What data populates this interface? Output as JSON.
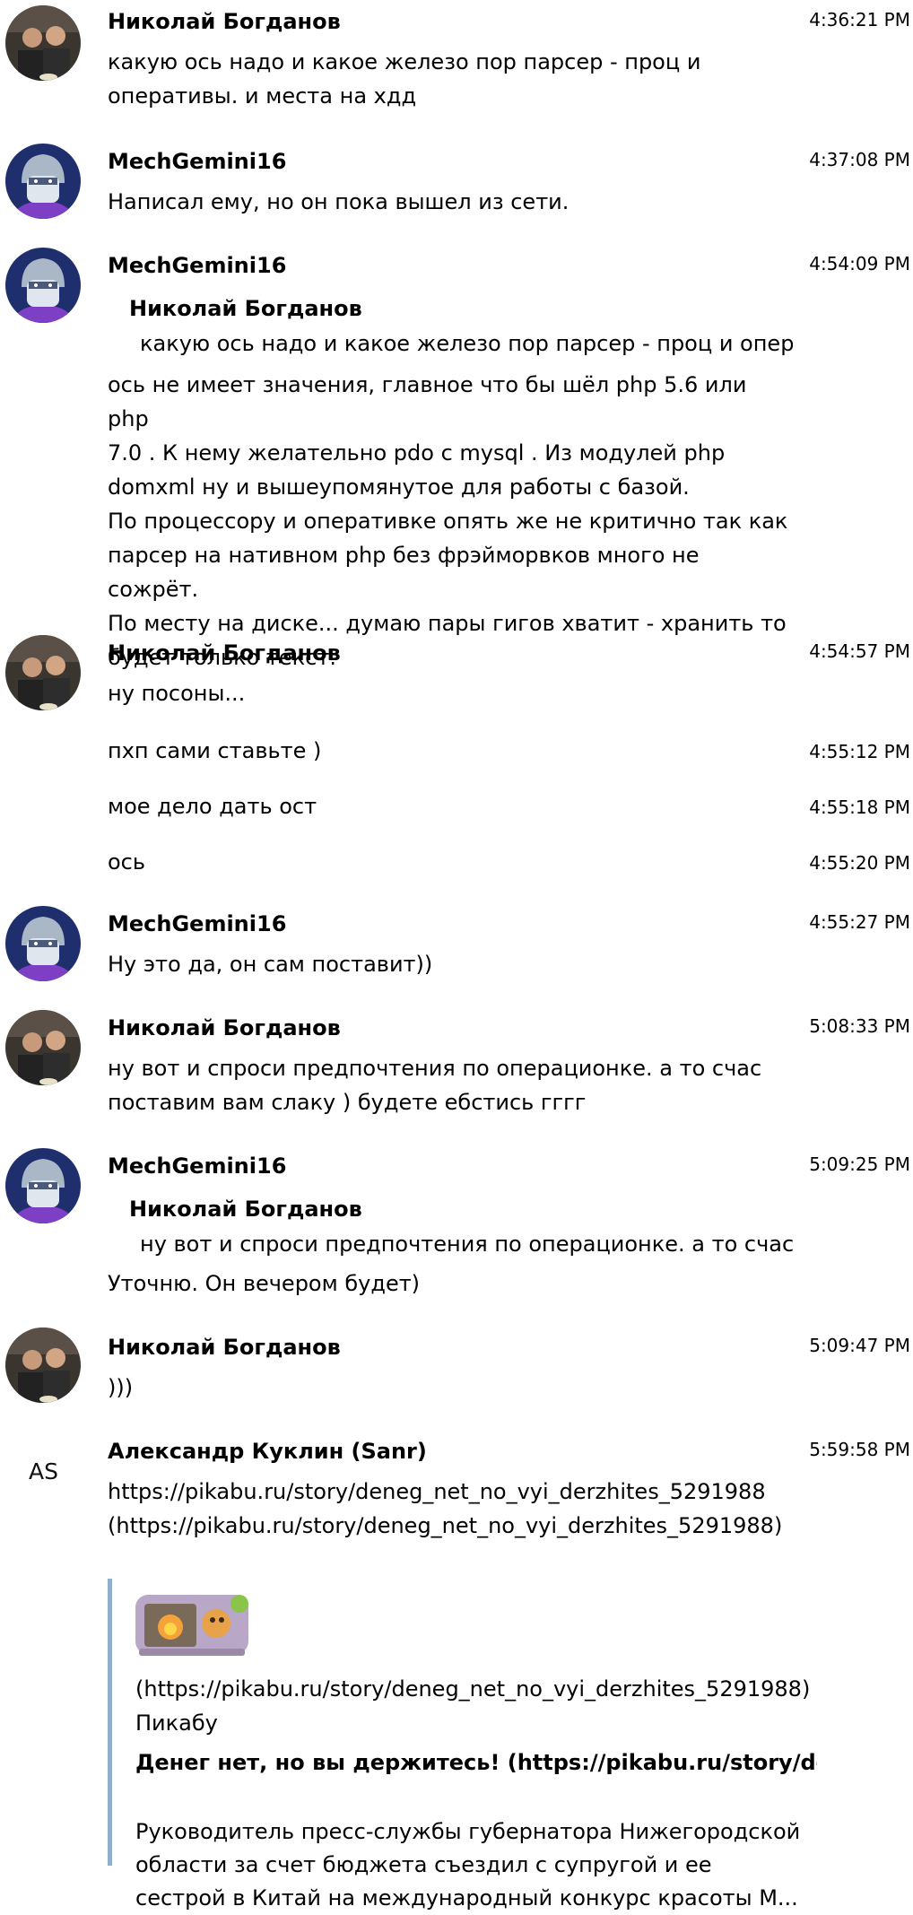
{
  "messages": [
    {
      "author": "Николай Богданов",
      "time": "4:36:21 PM",
      "text": "какую ось надо и какое железо пор парсер - проц и оперативы. и места на хдд"
    },
    {
      "author": "MechGemini16",
      "time": "4:37:08 PM",
      "text": "Написал ему, но он пока вышел из сети."
    },
    {
      "author": "MechGemini16",
      "time": "4:54:09 PM",
      "quote_author": "Николай Богданов",
      "quote_text": "какую ось надо и какое железо пор парсер - проц и опера…",
      "text_lines": [
        "ось не имеет значения, главное что бы шёл php 5.6 или php",
        "7.0  . К нему желательно pdo с mysql .  Из модулей php",
        "domxml ну и вышеупомянутое для работы с базой.",
        "По процессору и оперативке опять же не критично так как",
        "парсер на нативном php без фрэйморвков много не сожрёт.",
        "По месту на диске... думаю пары гигов хватит - хранить то",
        "будет только текст."
      ]
    },
    {
      "author": "Николай Богданов",
      "time": "4:54:57 PM",
      "text": "ну посоны..."
    },
    {
      "time": "4:55:12 PM",
      "text": "пхп сами ставьте )"
    },
    {
      "time": "4:55:18 PM",
      "text": "мое дело дать ост"
    },
    {
      "time": "4:55:20 PM",
      "text": "ось"
    },
    {
      "author": "MechGemini16",
      "time": "4:55:27 PM",
      "text": "Ну это да, он сам поставит))"
    },
    {
      "author": "Николай Богданов",
      "time": "5:08:33 PM",
      "text": "ну вот и спроси предпочтения по операционке. а то счас поставим вам слаку ) будете ебстись гггг"
    },
    {
      "author": "MechGemini16",
      "time": "5:09:25 PM",
      "quote_author": "Николай Богданов",
      "quote_text": "ну вот и спроси предпочтения по операционке. а то счас п…",
      "text": "Уточню. Он вечером будет)"
    },
    {
      "author": "Николай Богданов",
      "time": "5:09:47 PM",
      "text": ")))"
    },
    {
      "author": "Александр Куклин (Sanr)",
      "initials": "AS",
      "time": "5:59:58 PM",
      "text": "https://pikabu.ru/story/deneg_net_no_vyi_derzhites_5291988 (https://pikabu.ru/story/deneg_net_no_vyi_derzhites_5291988)",
      "card": {
        "url": "(https://pikabu.ru/story/deneg_net_no_vyi_derzhites_5291988)",
        "site": "Пикабу",
        "title": "Денег нет, но вы держитесь! (https://pikabu.ru/story/deneg_net_no_vyi_derzhites_",
        "description": "Руководитель пресс-службы губернатора Нижегородской области за счет бюджета съездил с супругой и ее сестрой в Китай на международный конкурс красоты М..."
      }
    }
  ],
  "colors": {
    "quote_bar": "#8fb0cc",
    "text": "#000000",
    "background": "#ffffff"
  }
}
